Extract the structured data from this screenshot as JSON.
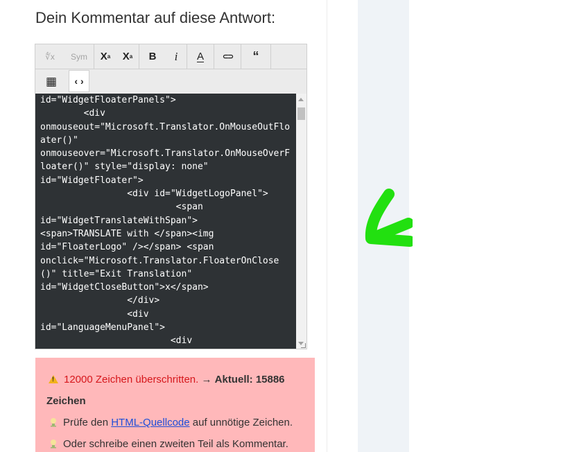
{
  "heading": "Dein Kommentar auf diese Antwort:",
  "toolbar": {
    "formula_label": "∜x",
    "symbol_label": "Sym",
    "superscript_label": "X",
    "superscript_mark": "a",
    "subscript_label": "X",
    "subscript_mark": "a",
    "bold_label": "B",
    "italic_label": "i",
    "color_label": "A",
    "link_label": "⊂⊃",
    "quote_label": "“",
    "table_label": "▦",
    "source_label": "‹ ›"
  },
  "editor": {
    "code": "id=\"WidgetFloaterPanels\">\n        <div\nonmouseout=\"Microsoft.Translator.OnMouseOutFloater()\"\nonmouseover=\"Microsoft.Translator.OnMouseOverFloater()\" style=\"display: none\"\nid=\"WidgetFloater\">\n                <div id=\"WidgetLogoPanel\">\n                         <span\nid=\"WidgetTranslateWithSpan\">\n<span>TRANSLATE with </span><img\nid=\"FloaterLogo\" /></span> <span\nonclick=\"Microsoft.Translator.FloaterOnClose()\" title=\"Exit Translation\"\nid=\"WidgetCloseButton\">x</span>\n                </div>\n                <div\nid=\"LanguageMenuPanel\">\n                        <div\nclass=\"DDStyle_outer\">"
  },
  "warning": {
    "limit_text": "12000 Zeichen überschritten.",
    "arrow_text": " → ",
    "current_label": "Aktuell: 15886",
    "unit": "Zeichen",
    "hint1_before": "Prüfe den ",
    "hint1_link": "HTML-Quellcode",
    "hint1_after": " auf unnötige Zeichen.",
    "hint2": "Oder schreibe einen zweiten Teil als Kommentar."
  },
  "colors": {
    "editor_bg": "#2e3235",
    "warning_bg": "#ffb8ba",
    "warning_red": "#d6171c",
    "arrow_green": "#22e010",
    "panel_bg": "#eff3f7"
  }
}
